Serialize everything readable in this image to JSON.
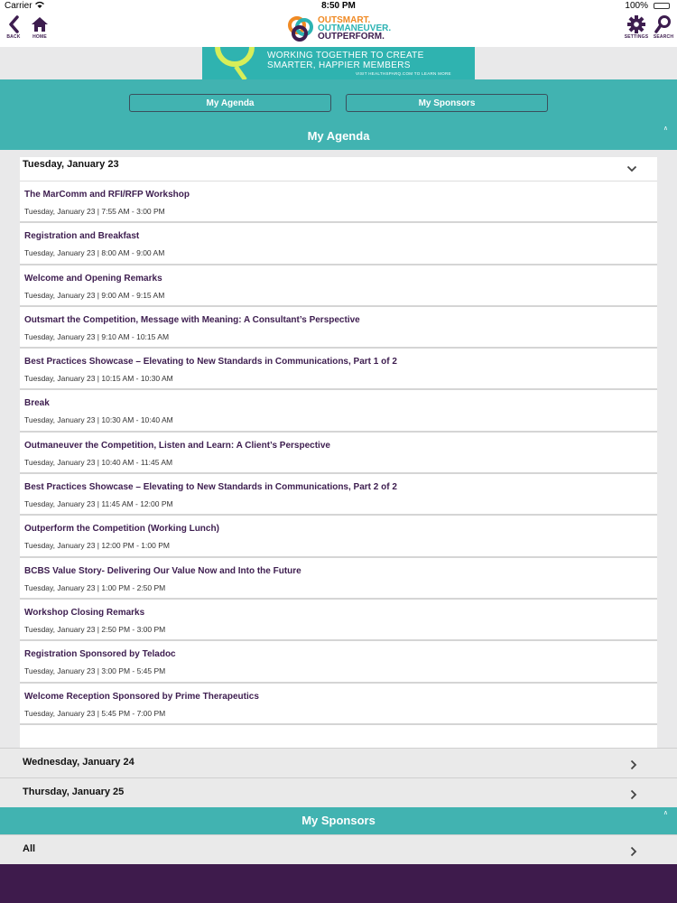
{
  "status": {
    "carrier": "Carrier",
    "time": "8:50 PM",
    "battery": "100%"
  },
  "nav": {
    "back_label": "BACK",
    "home_label": "HOME",
    "settings_label": "SETTINGS",
    "search_label": "SEARCH"
  },
  "logo": {
    "line1": "OUTSMART.",
    "line2": "OUTMANEUVER.",
    "line3": "OUTPERFORM."
  },
  "banner": {
    "headline_line1": "WORKING TOGETHER TO CREATE",
    "headline_line2": "SMARTER, HAPPIER MEMBERS",
    "sub": "VISIT HEALTHSPARQ.COM TO LEARN MORE"
  },
  "tabs": {
    "agenda": "My Agenda",
    "sponsors": "My Sponsors"
  },
  "agenda": {
    "header": "My Agenda",
    "day1": "Tuesday, January 23",
    "sessions": [
      {
        "title": "The MarComm and RFI/RFP Workshop",
        "time": "Tuesday, January 23 | 7:55 AM - 3:00 PM"
      },
      {
        "title": "Registration and Breakfast",
        "time": "Tuesday, January 23 | 8:00 AM - 9:00 AM"
      },
      {
        "title": "Welcome and Opening Remarks",
        "time": "Tuesday, January 23 | 9:00 AM - 9:15 AM"
      },
      {
        "title": "Outsmart the Competition, Message with Meaning: A Consultant’s Perspective",
        "time": "Tuesday, January 23 | 9:10 AM - 10:15 AM"
      },
      {
        "title": "Best Practices Showcase – Elevating to New Standards in Communications, Part 1 of 2",
        "time": "Tuesday, January 23 | 10:15 AM - 10:30 AM"
      },
      {
        "title": "Break",
        "time": "Tuesday, January 23 | 10:30 AM - 10:40 AM"
      },
      {
        "title": "Outmaneuver the Competition, Listen and Learn: A Client’s Perspective",
        "time": "Tuesday, January 23 | 10:40 AM - 11:45 AM"
      },
      {
        "title": "Best Practices Showcase – Elevating to New Standards in Communications, Part 2 of 2",
        "time": "Tuesday, January 23 | 11:45 AM - 12:00 PM"
      },
      {
        "title": "Outperform the Competition (Working Lunch)",
        "time": "Tuesday, January 23 | 12:00 PM - 1:00 PM"
      },
      {
        "title": "BCBS Value Story- Delivering Our Value Now and Into the Future",
        "time": "Tuesday, January 23 | 1:00 PM - 2:50 PM"
      },
      {
        "title": "Workshop Closing Remarks",
        "time": "Tuesday, January 23 | 2:50 PM - 3:00 PM"
      },
      {
        "title": "Registration Sponsored by Teladoc",
        "time": "Tuesday, January 23 | 3:00 PM - 5:45 PM"
      },
      {
        "title": "Welcome Reception Sponsored by Prime Therapeutics",
        "time": "Tuesday, January 23 | 5:45 PM - 7:00 PM"
      }
    ],
    "day2": "Wednesday, January 24",
    "day3": "Thursday, January 25"
  },
  "sponsors": {
    "header": "My Sponsors",
    "all": "All"
  },
  "colors": {
    "teal": "#41b3b1",
    "purple": "#3d1d4f",
    "orange": "#f08a24"
  }
}
